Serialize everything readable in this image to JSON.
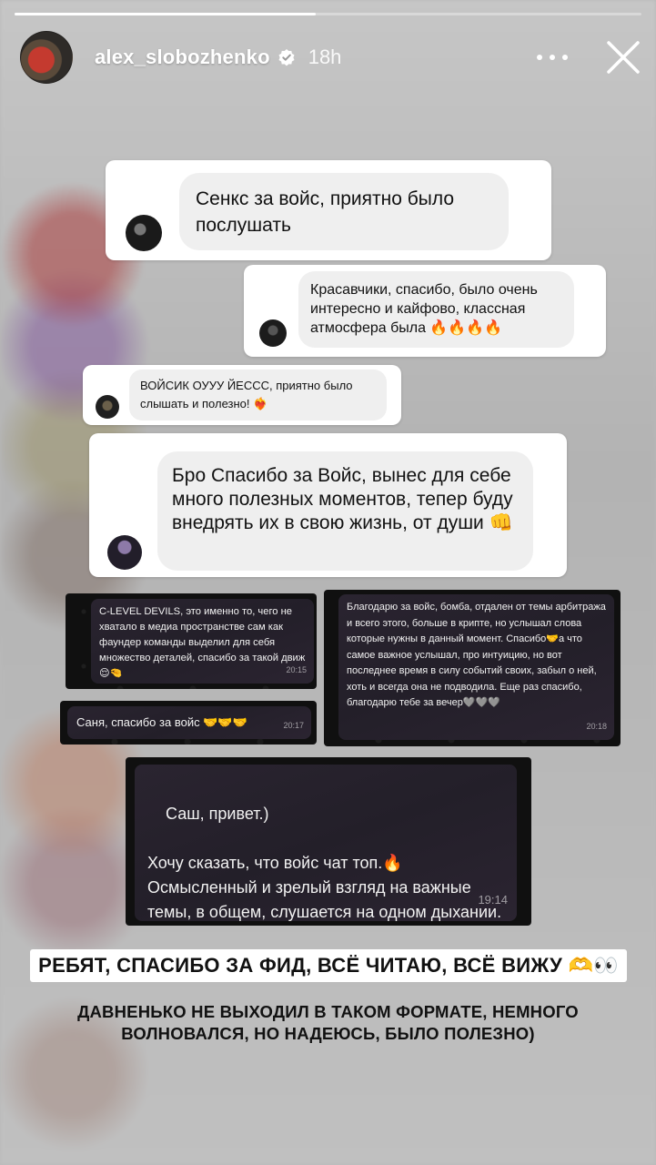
{
  "story": {
    "progress": 0.48,
    "username": "alex_slobozhenko",
    "time_ago": "18h"
  },
  "messages": [
    {
      "text": "Сенкс за войс, приятно было послушать"
    },
    {
      "text": "Красавчики, спасибо, было очень интересно и кайфово, классная атмосфера была 🔥🔥🔥🔥"
    },
    {
      "text": "ВОЙСИК ОУУУ ЙЕССС, приятно было слышать и полезно! ❤️‍🔥"
    },
    {
      "text": "Бро Спасибо за Войс, вынес для себе много полезных моментов, тепер буду внедрять их в свою жизнь, от души 👊"
    }
  ],
  "tg_messages": [
    {
      "text": "C-LEVEL DEVILS, это именно то, чего не хватало в медиа пространстве сам как фаундер команды выделил для себя множество деталей, спасибо за такой движ 😌🤏",
      "time": "20:15"
    },
    {
      "text": "Саня, спасибо за войс 🤝🤝🤝",
      "time": "20:17"
    },
    {
      "text": "Благодарю за войс, бомба, отдален от темы арбитража и всего этого, больше в крипте, но услышал слова которые нужны в данный момент. Спасибо🤝а что самое важное услышал, про интуицию, но вот последнее время в силу событий своих, забыл о ней, хоть и всегда она не подводила. Еще раз спасибо, благодарю тебе за вечер🩶🩶🩶",
      "time": "20:18"
    },
    {
      "text": "Саш, привет.)\n\nХочу сказать, что войс чат топ.🔥 Осмысленный и зрелый взгляд на важные темы, в общем, слушается на одном дыхании.",
      "time": "19:14"
    }
  ],
  "captions": {
    "line1": "РЕБЯТ, СПАСИБО ЗА ФИД, ВСЁ ЧИТАЮ, ВСЁ ВИЖУ 🫶👀",
    "line2": "ДАВНЕНЬКО НЕ ВЫХОДИЛ В ТАКОМ ФОРМАТЕ, НЕМНОГО ВОЛНОВАЛСЯ, НО НАДЕЮСЬ, БЫЛО ПОЛЕЗНО)"
  },
  "icons": {
    "verified": "verified-badge-icon",
    "more": "more-dots-icon",
    "close": "close-icon"
  },
  "colors": {
    "card_light": "#ffffff",
    "bubble_light": "#efefef",
    "bubble_dark": "#2a2430",
    "caption_bg": "#ffffff"
  }
}
